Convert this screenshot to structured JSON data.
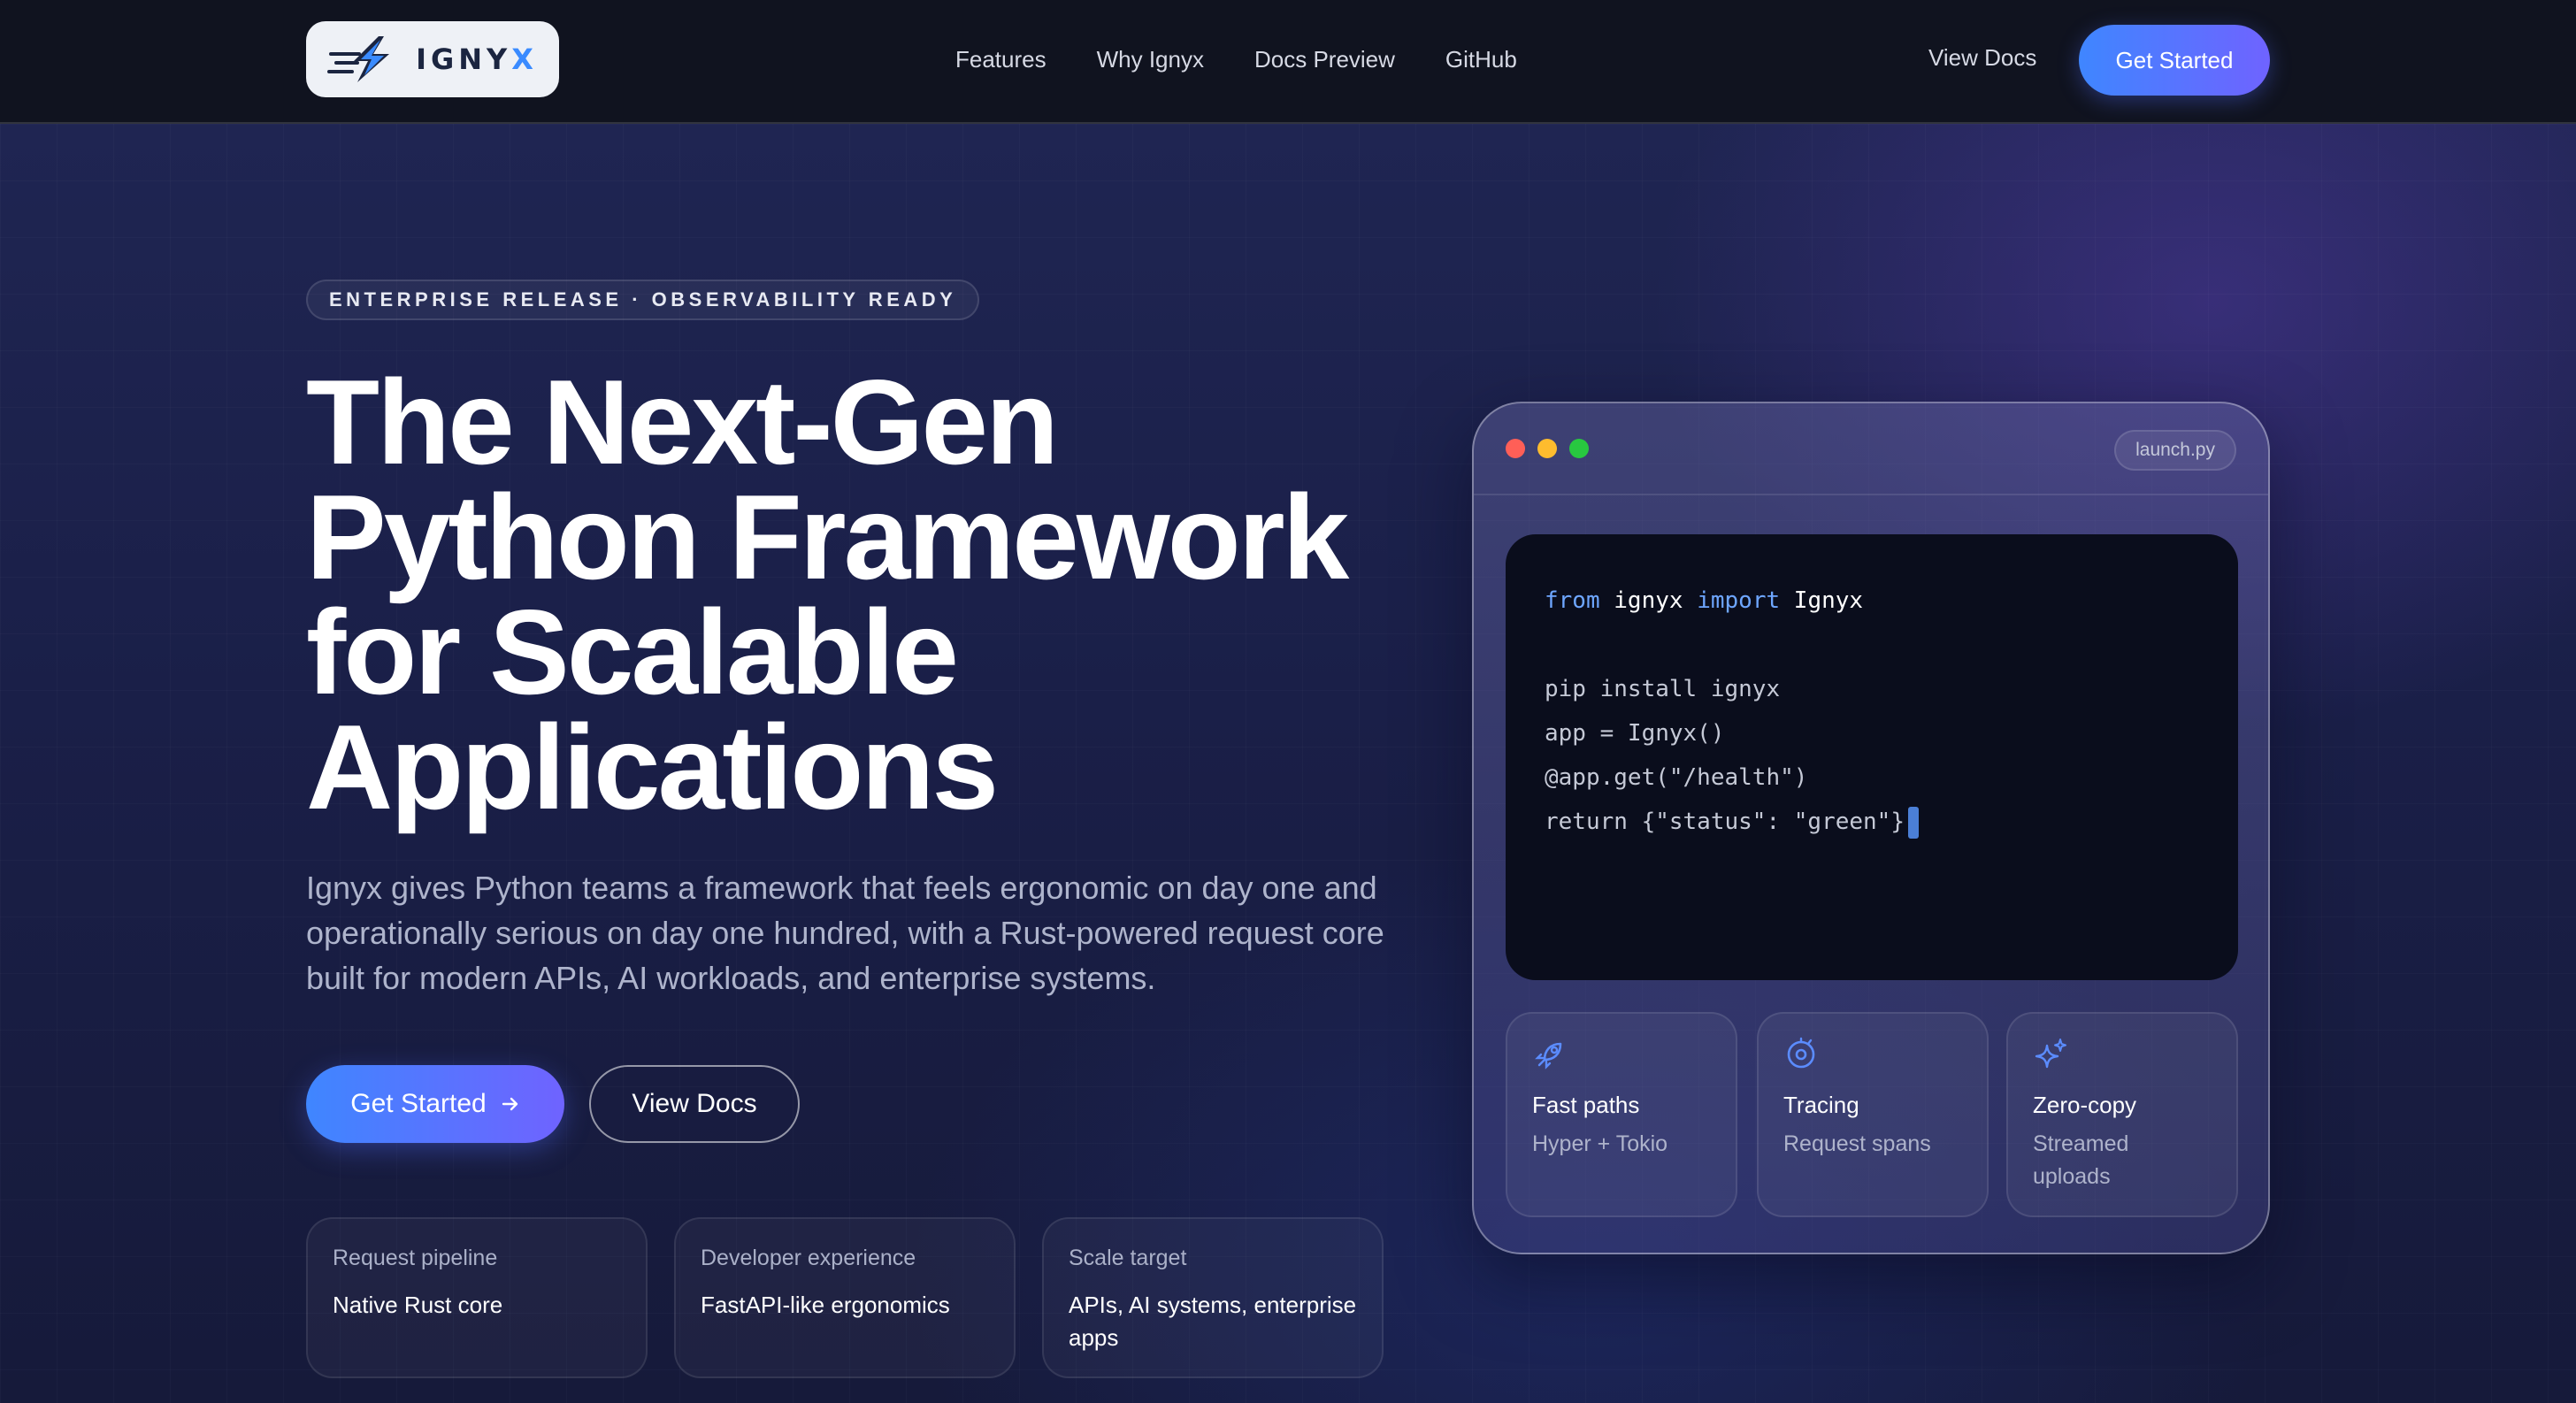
{
  "nav": {
    "logo_text": "IGNYX",
    "links": [
      "Features",
      "Why Ignyx",
      "Docs Preview",
      "GitHub"
    ],
    "view_docs": "View Docs",
    "cta": "Get Started"
  },
  "hero": {
    "eyebrow": "ENTERPRISE RELEASE · OBSERVABILITY READY",
    "headline": "The Next-Gen Python Framework for Scalable Applications",
    "subtext": "Ignyx gives Python teams a framework that feels ergonomic on day one and operationally serious on day one hundred, with a Rust-powered request core built for modern APIs, AI workloads, and enterprise systems.",
    "primary_button": "Get Started",
    "primary_button_icon": "arrow-right-icon",
    "secondary_button": "View Docs",
    "stats": [
      {
        "label": "Request pipeline",
        "value": "Native Rust core"
      },
      {
        "label": "Developer experience",
        "value": "FastAPI-like ergonomics"
      },
      {
        "label": "Scale target",
        "value": "APIs, AI systems, enterprise apps"
      }
    ]
  },
  "code_card": {
    "filename": "launch.py",
    "line1": {
      "kw1": "from",
      "mod": "ignyx",
      "kw2": "import",
      "name": "Ignyx"
    },
    "lines": [
      "pip install ignyx",
      "app = Ignyx()",
      "@app.get(\"/health\")",
      "return {\"status\": \"green\"}"
    ],
    "features": [
      {
        "icon": "rocket-icon",
        "title": "Fast paths",
        "desc": "Hyper + Tokio"
      },
      {
        "icon": "tracing-icon",
        "title": "Tracing",
        "desc": "Request spans"
      },
      {
        "icon": "sparkles-icon",
        "title": "Zero-copy",
        "desc": "Streamed uploads"
      }
    ]
  },
  "colors": {
    "accent_start": "#3f86ff",
    "accent_end": "#6f63ff",
    "keyword": "#6ea6ff",
    "dot_red": "#ff5f57",
    "dot_yellow": "#febc2e",
    "dot_green": "#28c840"
  }
}
